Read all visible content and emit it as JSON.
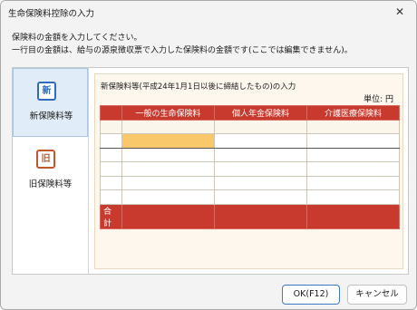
{
  "window": {
    "title": "生命保険料控除の入力",
    "close_glyph": "✕"
  },
  "instructions": {
    "line1": "保険料の金額を入力してください。",
    "line2": "一行目の金額は、給与の源泉徴収票で入力した保険料の金額です(ここでは編集できません)。"
  },
  "sidebar": {
    "items": [
      {
        "icon_text": "新",
        "label": "新保険料等",
        "icon": "new-icon",
        "color": "#2f6cc0"
      },
      {
        "icon_text": "旧",
        "label": "旧保険料等",
        "icon": "old-icon",
        "color": "#c0592a"
      }
    ]
  },
  "content": {
    "title": "新保険料等(平成24年1月1日以後に締結したもの)の入力",
    "unit": "単位:  円",
    "table": {
      "headers": [
        "",
        "一般の生命保険料",
        "個人年金保険料",
        "介護医療保険料"
      ],
      "rows": [
        [
          "",
          "",
          "",
          ""
        ],
        [
          "",
          "",
          "",
          ""
        ],
        [
          "",
          "",
          "",
          ""
        ],
        [
          "",
          "",
          "",
          ""
        ],
        [
          "",
          "",
          "",
          ""
        ],
        [
          "",
          "",
          "",
          ""
        ]
      ],
      "total_label": "合計"
    }
  },
  "buttons": {
    "ok": "OK(F12)",
    "cancel": "キャンセル"
  },
  "colors": {
    "accent_red": "#c93a2e",
    "active_cell": "#f9c86a",
    "sidebar_active": "#e0ecf7",
    "content_bg": "#fdf7ee"
  }
}
